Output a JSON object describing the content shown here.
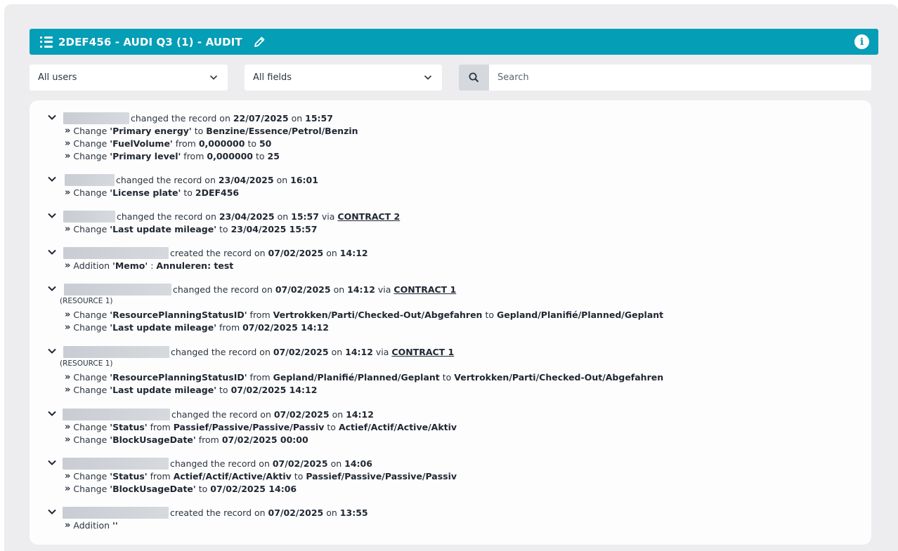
{
  "header": {
    "title": "2DEF456 - AUDI Q3 (1) - AUDIT"
  },
  "filters": {
    "users_select": "All users",
    "fields_select": "All fields",
    "search_placeholder": "Search"
  },
  "entries": [
    {
      "action": "changed the record on",
      "date": "22/07/2025",
      "on": "on",
      "time": "15:57",
      "changes": [
        {
          "prefix": "Change",
          "field": "'Primary energy'",
          "conj1": "to",
          "val1": "Benzine/Essence/Petrol/Benzin"
        },
        {
          "prefix": "Change",
          "field": "'FuelVolume'",
          "conj1": "from",
          "val1": "0,000000",
          "conj2": "to",
          "val2": "50"
        },
        {
          "prefix": "Change",
          "field": "'Primary level'",
          "conj1": "from",
          "val1": "0,000000",
          "conj2": "to",
          "val2": "25"
        }
      ]
    },
    {
      "action": "changed the record on",
      "date": "23/04/2025",
      "on": "on",
      "time": "16:01",
      "changes": [
        {
          "prefix": "Change",
          "field": "'License plate'",
          "conj1": "to",
          "val1": "2DEF456"
        }
      ]
    },
    {
      "action": "changed the record on",
      "date": "23/04/2025",
      "on": "on",
      "time": "15:57",
      "via": "via",
      "link": "CONTRACT 2",
      "changes": [
        {
          "prefix": "Change",
          "field": "'Last update mileage'",
          "conj1": "to",
          "val1": "23/04/2025 15:57"
        }
      ]
    },
    {
      "action": "created the record on",
      "date": "07/02/2025",
      "on": "on",
      "time": "14:12",
      "changes": [
        {
          "prefix": "Addition",
          "field": "'Memo'",
          "conj1": ":",
          "val1": "Annuleren: test"
        }
      ]
    },
    {
      "action": "changed the record on",
      "date": "07/02/2025",
      "on": "on",
      "time": "14:12",
      "via": "via",
      "link": "CONTRACT 1",
      "resource": "(RESOURCE 1)",
      "changes": [
        {
          "prefix": "Change",
          "field": "'ResourcePlanningStatusID'",
          "conj1": "from",
          "val1": "Vertrokken/Parti/Checked-Out/Abgefahren",
          "conj2": "to",
          "val2": "Gepland/Planifié/Planned/Geplant"
        },
        {
          "prefix": "Change",
          "field": "'Last update mileage'",
          "conj1": "from",
          "val1": "07/02/2025 14:12"
        }
      ]
    },
    {
      "action": "changed the record on",
      "date": "07/02/2025",
      "on": "on",
      "time": "14:12",
      "via": "via",
      "link": "CONTRACT 1",
      "resource": "(RESOURCE 1)",
      "changes": [
        {
          "prefix": "Change",
          "field": "'ResourcePlanningStatusID'",
          "conj1": "from",
          "val1": "Gepland/Planifié/Planned/Geplant",
          "conj2": "to",
          "val2": "Vertrokken/Parti/Checked-Out/Abgefahren"
        },
        {
          "prefix": "Change",
          "field": "'Last update mileage'",
          "conj1": "to",
          "val1": "07/02/2025 14:12"
        }
      ]
    },
    {
      "action": "changed the record on",
      "date": "07/02/2025",
      "on": "on",
      "time": "14:12",
      "changes": [
        {
          "prefix": "Change",
          "field": "'Status'",
          "conj1": "from",
          "val1": "Passief/Passive/Passive/Passiv",
          "conj2": "to",
          "val2": "Actief/Actif/Active/Aktiv"
        },
        {
          "prefix": "Change",
          "field": "'BlockUsageDate'",
          "conj1": "from",
          "val1": "07/02/2025 00:00"
        }
      ]
    },
    {
      "action": "changed the record on",
      "date": "07/02/2025",
      "on": "on",
      "time": "14:06",
      "changes": [
        {
          "prefix": "Change",
          "field": "'Status'",
          "conj1": "from",
          "val1": "Actief/Actif/Active/Aktiv",
          "conj2": "to",
          "val2": "Passief/Passive/Passive/Passiv"
        },
        {
          "prefix": "Change",
          "field": "'BlockUsageDate'",
          "conj1": "to",
          "val1": "07/02/2025 14:06"
        }
      ]
    },
    {
      "action": "created the record on",
      "date": "07/02/2025",
      "on": "on",
      "time": "13:55",
      "changes": [
        {
          "prefix": "Addition",
          "field": "''"
        }
      ]
    }
  ]
}
